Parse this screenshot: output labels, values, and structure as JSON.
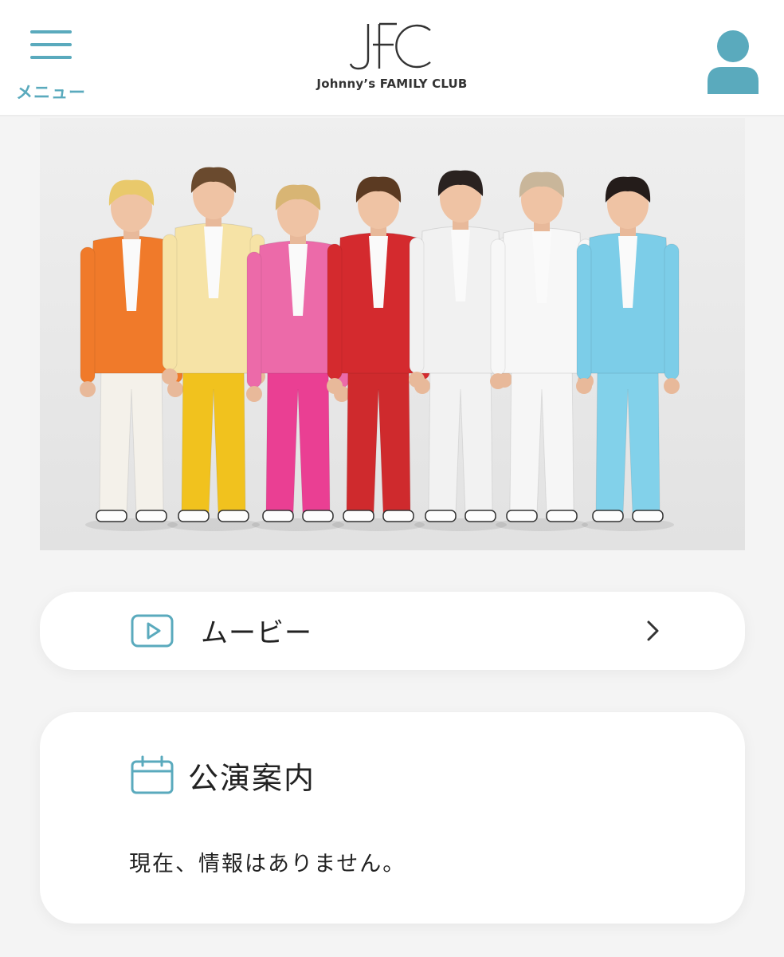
{
  "header": {
    "menu_label": "メニュー",
    "logo_mark": "JFC",
    "logo_text": "Johnny’s FAMILY CLUB",
    "menu_icon": "hamburger-icon",
    "account_icon": "user-icon"
  },
  "colors": {
    "accent": "#5aaabd",
    "background": "#f4f4f4",
    "card": "#ffffff",
    "text": "#222222"
  },
  "hero": {
    "icon": "group-photo",
    "suit_colors": [
      "#f07a2a",
      "#f6e3a6",
      "#ec6aa9",
      "#d42a2e",
      "#f1f1f1",
      "#f7f7f7",
      "#7ccde8"
    ],
    "pants_colors": [
      "#f4f1ea",
      "#f1c21e",
      "#ea3f93",
      "#cf2a2d",
      "#f2f2f2",
      "#f6f6f6",
      "#82d1ea"
    ]
  },
  "movie": {
    "title": "ムービー",
    "icon": "play-icon",
    "arrow_icon": "chevron-right-icon"
  },
  "performance": {
    "title": "公演案内",
    "icon": "calendar-icon",
    "message": "現在、情報はありません。"
  }
}
